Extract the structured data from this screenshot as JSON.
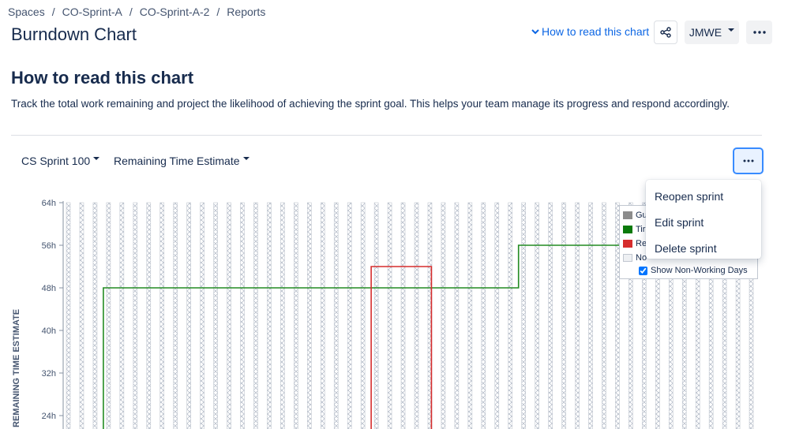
{
  "breadcrumb": {
    "items": [
      "Spaces",
      "CO-Sprint-A",
      "CO-Sprint-A-2",
      "Reports"
    ],
    "separator": "/"
  },
  "header": {
    "title": "Burndown Chart",
    "how_to_link": "How to read this chart",
    "user_button": "JMWE",
    "share_icon": "share-icon",
    "more_icon": "more-horizontal-icon"
  },
  "guide": {
    "title": "How to read this chart",
    "description": "Track the total work remaining and project the likelihood of achieving the sprint goal. This helps your team manage its progress and respond accordingly."
  },
  "controls": {
    "sprint_select": "CS Sprint 100",
    "estimate_select": "Remaining Time Estimate"
  },
  "menu": {
    "items": [
      "Reopen sprint",
      "Edit sprint",
      "Delete sprint"
    ]
  },
  "legend": {
    "items": [
      {
        "label": "Gu",
        "color": "#8c8c8c"
      },
      {
        "label": "Tir",
        "color": "#0b7a0b"
      },
      {
        "label": "Re",
        "color": "#d62d2d"
      },
      {
        "label": "No",
        "color": "#dfe1e6"
      }
    ],
    "non_working_days_label": "Show Non-Working Days",
    "show_non_working_days": true
  },
  "colors": {
    "link": "#0c66e4",
    "time_spent": "#228b22",
    "remaining": "#d62d2d",
    "non_working": "#c1c7d0"
  },
  "chart_data": {
    "type": "line",
    "ylabel": "REMAINING TIME ESTIMATE",
    "y_ticks": [
      "64h",
      "56h",
      "48h",
      "40h",
      "32h",
      "24h"
    ],
    "ylim": [
      20,
      64
    ],
    "x_range": [
      0,
      52
    ],
    "non_working_day_columns": 52,
    "series": [
      {
        "points": [
          [
            3,
            20
          ],
          [
            3,
            48
          ],
          [
            34,
            48
          ],
          [
            34,
            56
          ],
          [
            43,
            56
          ]
        ]
      },
      {
        "points": [
          [
            23,
            20
          ],
          [
            23,
            52
          ],
          [
            27.5,
            52
          ],
          [
            27.5,
            20
          ]
        ]
      }
    ]
  }
}
